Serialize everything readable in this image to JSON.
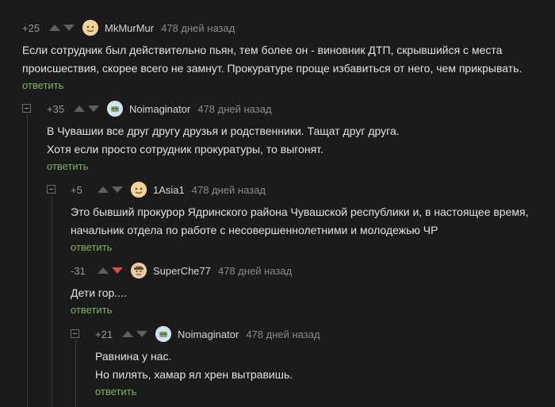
{
  "comments": [
    {
      "rating": "+25",
      "username": "MkMurMur",
      "time": "478 дней назад",
      "lines": [
        "Если сотрудник был действительно пьян, тем более он - виновник ДТП, скрывшийся с места",
        "происшествия, скорее всего не замнут. Прокуратуре проще избавиться от него, чем прикрывать."
      ],
      "reply": "ответить",
      "avatar_color": "#f2d49a",
      "vote": "none"
    },
    {
      "rating": "+35",
      "username": "Noimaginator",
      "time": "478 дней назад",
      "lines": [
        "В Чувашии все друг другу друзья и родственники. Тащат друг друга.",
        "Хотя если просто сотрудник прокуратуры, то выгонят."
      ],
      "reply": "ответить",
      "avatar_color": "#cfe3f0",
      "vote": "none"
    },
    {
      "rating": "+5",
      "username": "1Asia1",
      "time": "478 дней назад",
      "lines": [
        "Это бывший прокурор Ядринского района Чувашской республики и, в настоящее время,",
        "начальник отдела по работе с несовершеннолетними и молодежью ЧР"
      ],
      "reply": "ответить",
      "avatar_color": "#f2d49a",
      "vote": "none"
    },
    {
      "rating": "-31",
      "username": "SuperChe77",
      "time": "478 дней назад",
      "lines": [
        "Дети гор...."
      ],
      "reply": "ответить",
      "avatar_color": "#e9c9a3",
      "vote": "down"
    },
    {
      "rating": "+21",
      "username": "Noimaginator",
      "time": "478 дней назад",
      "lines": [
        "Равнина у нас.",
        "Но пилять, хамар ял хрен вытравишь."
      ],
      "reply": "ответить",
      "avatar_color": "#cfe3f0",
      "vote": "none"
    }
  ]
}
